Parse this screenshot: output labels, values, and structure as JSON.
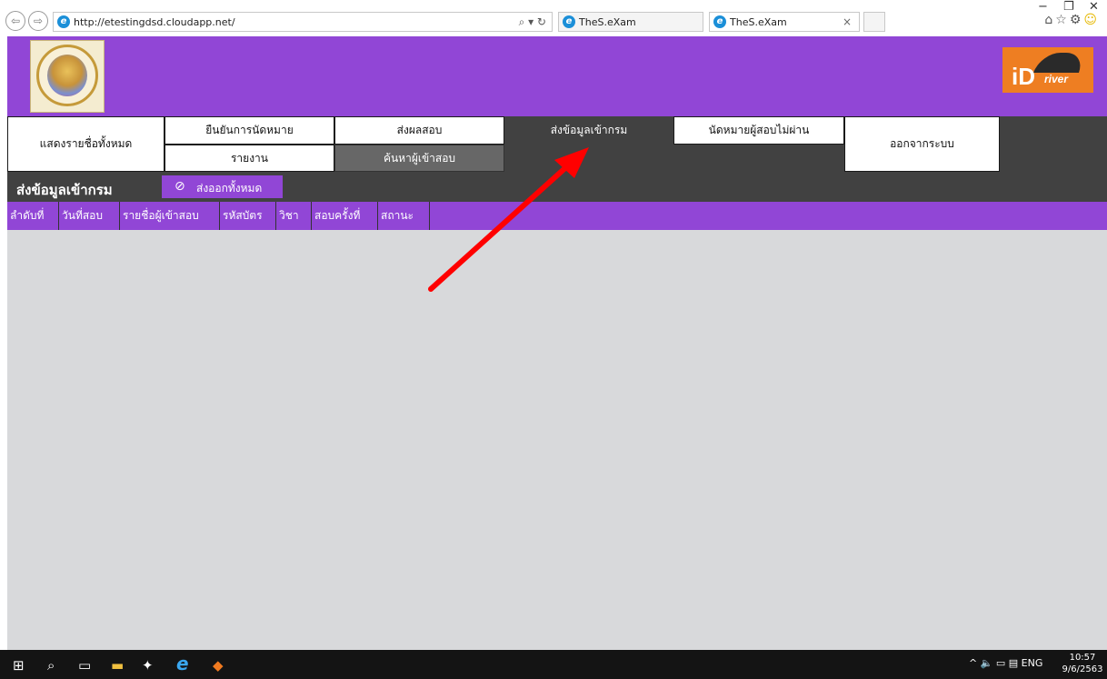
{
  "browser": {
    "back_glyph": "⇦",
    "forward_glyph": "⇨",
    "url": "http://etestingdsd.cloudapp.net/",
    "addr_tools": "⌕ ▾ ↻",
    "tabs": [
      {
        "label": "TheS.eXam",
        "close": ""
      },
      {
        "label": "TheS.eXam",
        "close": "×"
      }
    ],
    "window_controls": {
      "minimize": "−",
      "restore": "❐",
      "close": "✕"
    },
    "top_icons": {
      "home": "⌂",
      "favorites": "☆",
      "settings": "⚙",
      "feedback": "☺"
    }
  },
  "header": {
    "seal_icon": "department-seal",
    "logo_icon": "idriver-logo",
    "logo_text_i": "iD",
    "logo_text_driver": "river"
  },
  "menu": {
    "show_all": "แสดงรายชื่อทั้งหมด",
    "confirm_appointment": "ยืนยันการนัดหมาย",
    "report": "รายงาน",
    "send_results": "ส่งผลสอบ",
    "search_examinee": "ค้นหาผู้เข้าสอบ",
    "send_to_dept": "ส่งข้อมูลเข้ากรม",
    "appoint_failed": "นัดหมายผู้สอบไม่ผ่าน",
    "logout": "ออกจากระบบ"
  },
  "section": {
    "title": "ส่งข้อมูลเข้ากรม",
    "send_all_icon": "⊘",
    "send_all": "ส่งออกทั้งหมด"
  },
  "table": {
    "columns": [
      "ลำดับที่",
      "วันที่สอบ",
      "รายชื่อผู้เข้าสอบ",
      "รหัสบัตร",
      "วิชา",
      "สอบครั้งที่",
      "สถานะ"
    ]
  },
  "taskbar": {
    "start": "⊞",
    "search": "⌕",
    "task_view": "▭",
    "explorer": "▬",
    "app1": "✦",
    "ie": "e",
    "app2": "◆",
    "tray_items": "^ 🔈 ▭ ▤ ENG",
    "time": "10:57",
    "date": "9/6/2563"
  },
  "colors": {
    "accent_purple": "#9146d6",
    "menu_dark": "#414141",
    "content_gray": "#d8d9db",
    "arrow_red": "#ff0000"
  }
}
